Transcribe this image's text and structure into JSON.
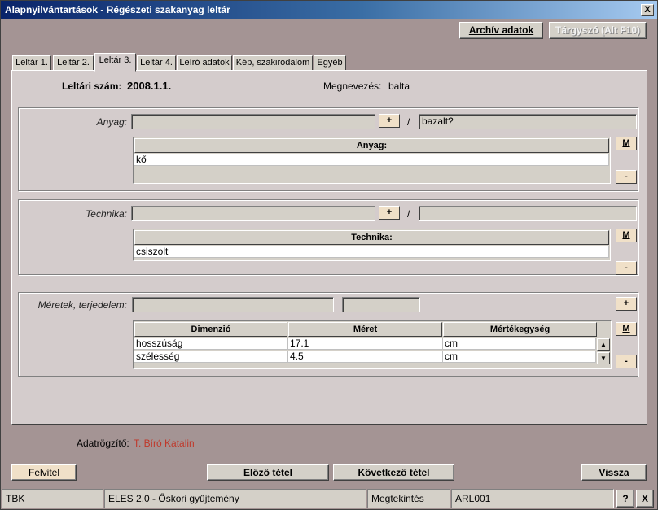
{
  "window": {
    "title": "Alapnyilvántartások - Régészeti szakanyag leltár",
    "close": "X"
  },
  "toolbar": {
    "archive_label": "Archív adatok",
    "subject_label": "Tárgyszó (Alt F10)"
  },
  "tabs": [
    "Leltár 1.",
    "Leltár 2.",
    "Leltár 3.",
    "Leltár 4.",
    "Leíró adatok",
    "Kép, szakirodalom",
    "Egyéb"
  ],
  "header": {
    "inv_label": "Leltári szám:",
    "inv_value": "2008.1.1.",
    "name_label": "Megnevezés:",
    "name_value": "balta"
  },
  "material": {
    "label": "Anyag:",
    "plus": "+",
    "slash": "/",
    "value2": "bazalt?",
    "col_header": "Anyag:",
    "rows": [
      "kő"
    ],
    "m_btn": "M",
    "minus_btn": "-"
  },
  "technique": {
    "label": "Technika:",
    "plus": "+",
    "slash": "/",
    "col_header": "Technika:",
    "rows": [
      "csiszolt"
    ],
    "m_btn": "M",
    "minus_btn": "-"
  },
  "dimensions": {
    "label": "Méretek, terjedelem:",
    "plus": "+",
    "m_btn": "M",
    "minus_btn": "-",
    "headers": [
      "Dimenzió",
      "Méret",
      "Mértékegység"
    ],
    "rows": [
      {
        "dim": "hosszúság",
        "val": "17.1",
        "unit": "cm"
      },
      {
        "dim": "szélesség",
        "val": "4.5",
        "unit": "cm"
      }
    ]
  },
  "recorder": {
    "label": "Adatrögzítő:",
    "value": "T. Bíró Katalin",
    "color": "#c0392b"
  },
  "footer": {
    "felvitel": "Felvitel",
    "prev": "Előző tétel",
    "next": "Következő tétel",
    "back": "Vissza"
  },
  "statusbar": {
    "s1": "TBK",
    "s2": "ELES 2.0 - Őskori gyűjtemény",
    "s3": "Megtekintés",
    "s4": "ARL001",
    "help": "?",
    "close": "X"
  }
}
